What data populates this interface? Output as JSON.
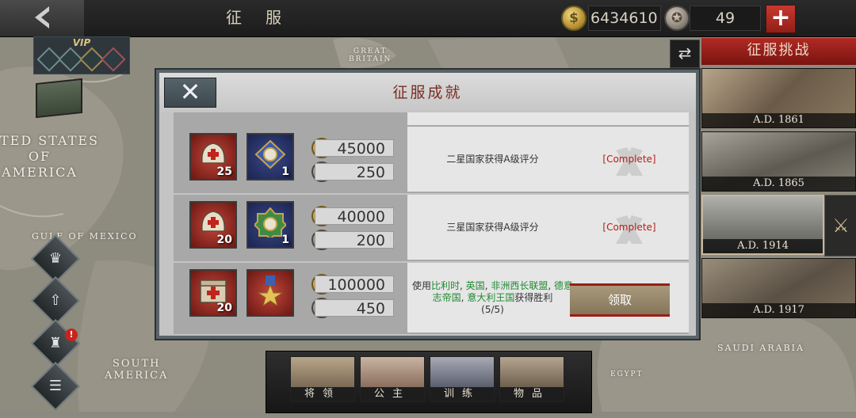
{
  "header": {
    "title": "征服",
    "gold_amount": "6434610",
    "medal_amount": "49",
    "coin_symbol": "$"
  },
  "vip": {
    "label": "VIP"
  },
  "map_labels": [
    {
      "key": "usa",
      "text": "TED STATES\nOF\nAMERICA"
    },
    {
      "key": "gulf",
      "text": "GULF OF MEXICO"
    },
    {
      "key": "south_america",
      "text": "SOUTH\nAMERICA"
    },
    {
      "key": "saudi",
      "text": "SAUDI ARABIA"
    },
    {
      "key": "britain",
      "text": "GREAT\nBRITAIN"
    },
    {
      "key": "egypt",
      "text": "EGYPT"
    }
  ],
  "right_panel": {
    "challenge_tab": "征服挑战",
    "eras": [
      {
        "label": "A.D. 1861"
      },
      {
        "label": "A.D. 1865"
      },
      {
        "label": "A.D. 1914"
      },
      {
        "label": "A.D. 1917"
      }
    ]
  },
  "bottom_tabs": [
    {
      "label": "将领"
    },
    {
      "label": "公主"
    },
    {
      "label": "训练"
    },
    {
      "label": "物品"
    }
  ],
  "modal": {
    "title": "征服成就",
    "close_label": "✕",
    "rows": [
      {
        "items": [
          {
            "qty": "25",
            "kind": "medic-helmet"
          },
          {
            "qty": "1",
            "kind": "blue-medal"
          }
        ],
        "gold": "45000",
        "medal": "250",
        "description": "二星国家获得A级评分",
        "status": "[Complete]"
      },
      {
        "items": [
          {
            "qty": "20",
            "kind": "medic-helmet"
          },
          {
            "qty": "1",
            "kind": "green-medal"
          }
        ],
        "gold": "40000",
        "medal": "200",
        "description": "三星国家获得A级评分",
        "status": "[Complete]"
      },
      {
        "items": [
          {
            "qty": "20",
            "kind": "medic-box"
          },
          {
            "qty": "",
            "kind": "star-medal"
          }
        ],
        "gold": "100000",
        "medal": "450",
        "description_parts": [
          {
            "text": "使用",
            "hl": false
          },
          {
            "text": "比利时",
            "hl": true
          },
          {
            "text": ", ",
            "hl": false
          },
          {
            "text": "英国",
            "hl": true
          },
          {
            "text": ", ",
            "hl": false
          },
          {
            "text": "非洲西长联盟",
            "hl": true
          },
          {
            "text": ", ",
            "hl": false
          },
          {
            "text": "德意志帝国",
            "hl": true
          },
          {
            "text": ", ",
            "hl": false
          },
          {
            "text": "意大利王国",
            "hl": true
          },
          {
            "text": "获得胜利",
            "hl": false
          }
        ],
        "progress": "(5/5)",
        "claim_label": "领取"
      }
    ]
  },
  "colors": {
    "accent_red": "#b02a24",
    "complete_red": "#b51e18",
    "highlight_green": "#1f8a32"
  }
}
